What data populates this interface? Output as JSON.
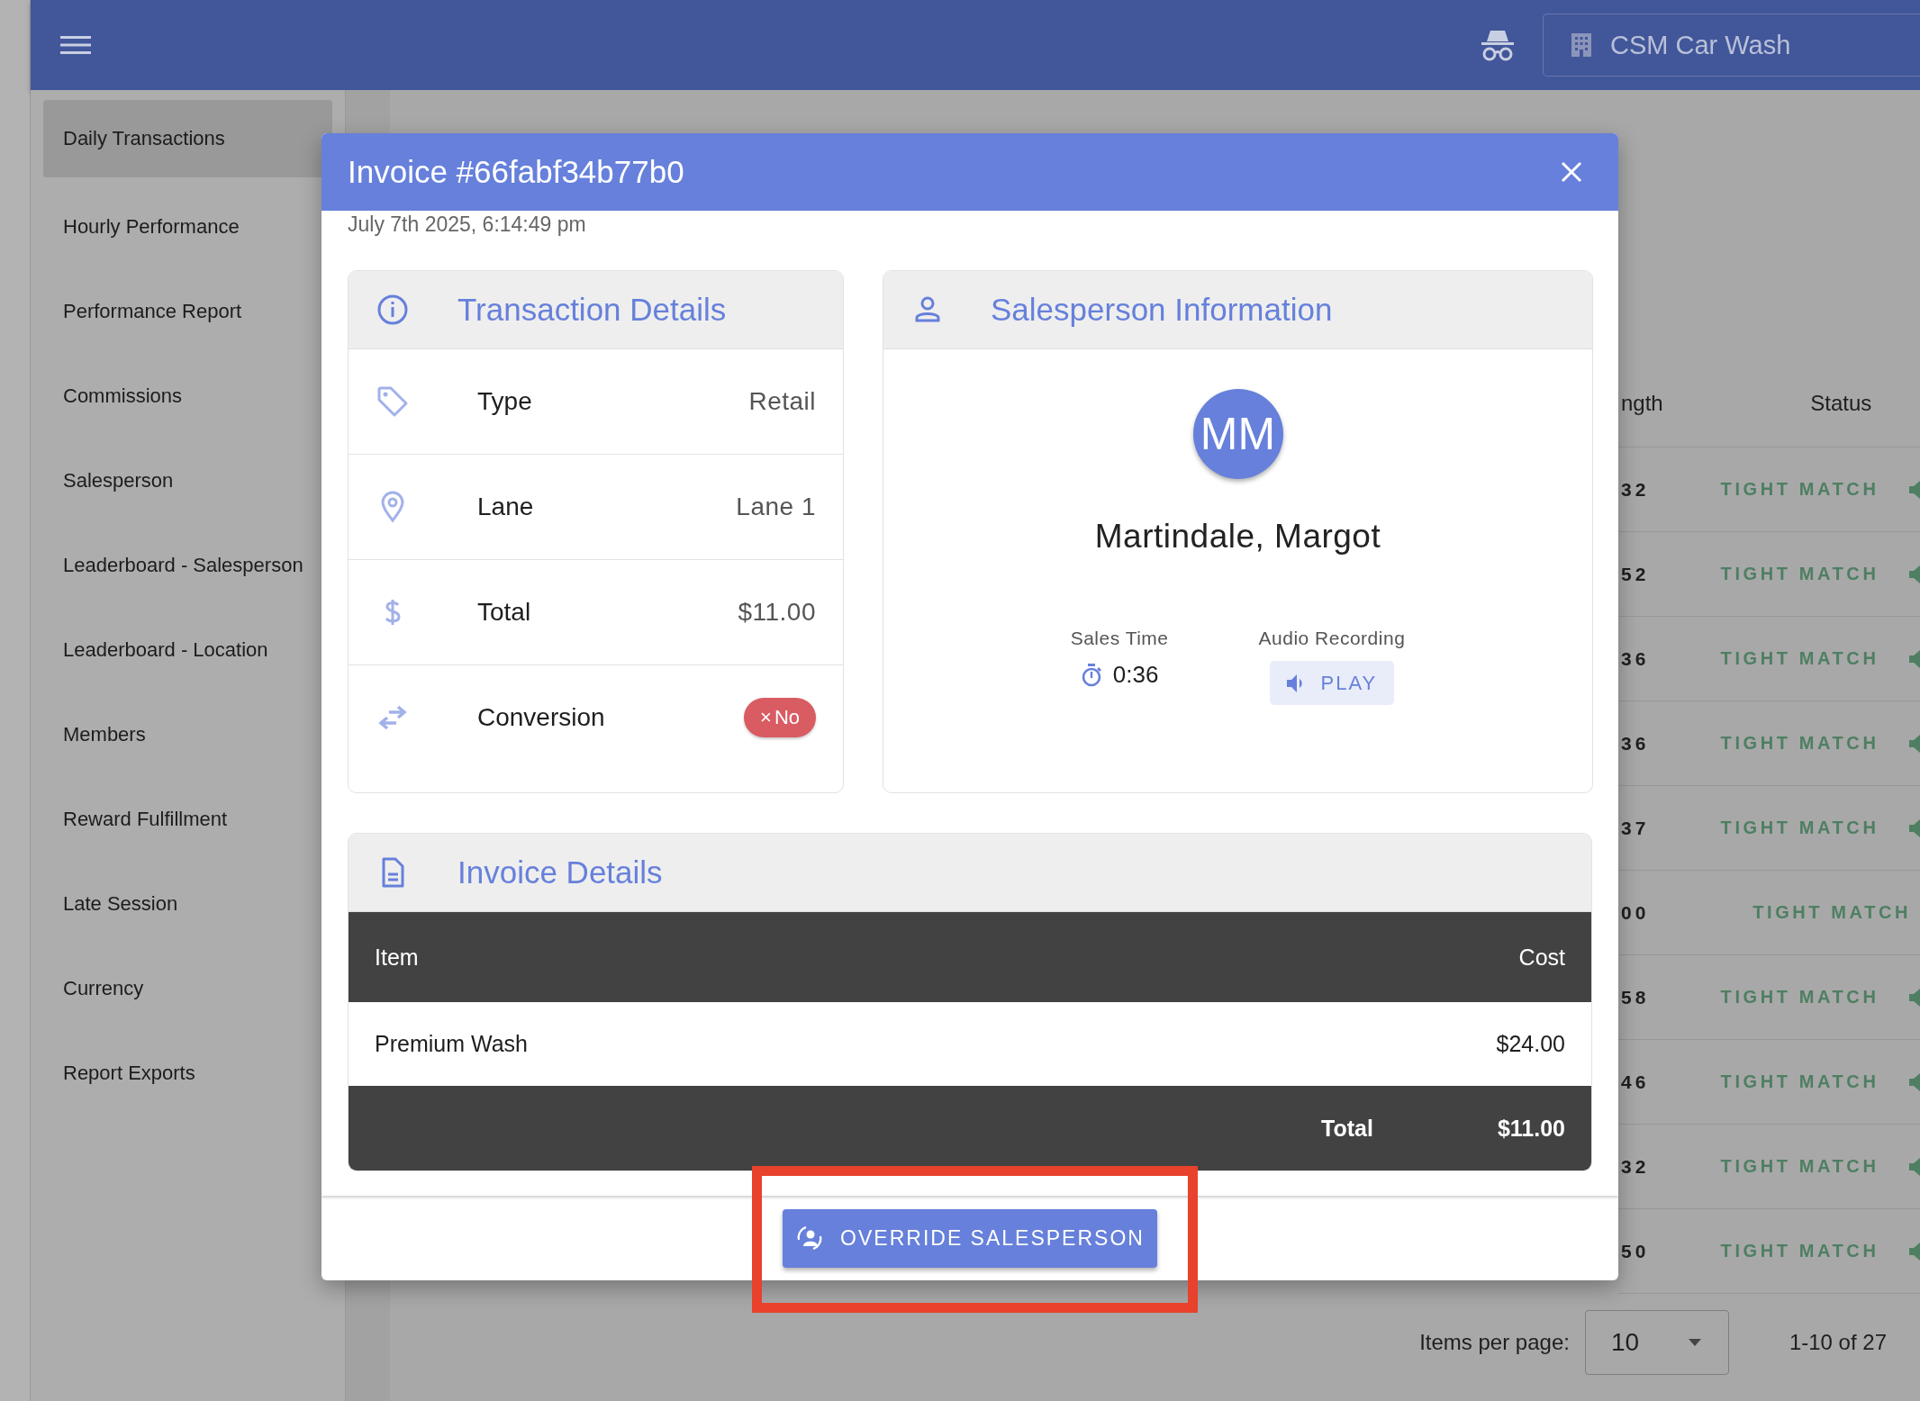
{
  "top_bar": {
    "location": "CSM Car Wash"
  },
  "sidebar": {
    "items": [
      {
        "label": "Daily Transactions",
        "selected": true
      },
      {
        "label": "Hourly Performance",
        "selected": false
      },
      {
        "label": "Performance Report",
        "selected": false
      },
      {
        "label": "Commissions",
        "selected": false
      },
      {
        "label": "Salesperson",
        "selected": false
      },
      {
        "label": "Leaderboard - Salesperson",
        "selected": false
      },
      {
        "label": "Leaderboard - Location",
        "selected": false
      },
      {
        "label": "Members",
        "selected": false
      },
      {
        "label": "Reward Fulfillment",
        "selected": false
      },
      {
        "label": "Late Session",
        "selected": false
      },
      {
        "label": "Currency",
        "selected": false
      },
      {
        "label": "Report Exports",
        "selected": false
      }
    ]
  },
  "table": {
    "columns": [
      "ngth",
      "Status"
    ],
    "rows": [
      {
        "column_1": "32",
        "status": "TIGHT MATCH",
        "has_audio": true
      },
      {
        "column_1": "52",
        "status": "TIGHT MATCH",
        "has_audio": true
      },
      {
        "column_1": "36",
        "status": "TIGHT MATCH",
        "has_audio": true
      },
      {
        "column_1": "36",
        "status": "TIGHT MATCH",
        "has_audio": true
      },
      {
        "column_1": "37",
        "status": "TIGHT MATCH",
        "has_audio": true
      },
      {
        "column_1": "00",
        "status": "TIGHT MATCH",
        "has_audio": false
      },
      {
        "column_1": "58",
        "status": "TIGHT MATCH",
        "has_audio": true
      },
      {
        "column_1": "46",
        "status": "TIGHT MATCH",
        "has_audio": true
      },
      {
        "column_1": "32",
        "status": "TIGHT MATCH",
        "has_audio": true
      },
      {
        "column_1": "50",
        "status": "TIGHT MATCH",
        "has_audio": true
      }
    ]
  },
  "pagination": {
    "label": "Items per page:",
    "items_per_page": "10",
    "range": "1-10 of 27"
  },
  "dialog": {
    "title": "Invoice #66fabf34b77b0",
    "date": "July 7th 2025, 6:14:49 pm",
    "transaction_details": {
      "title": "Transaction Details",
      "rows": [
        {
          "kind": "value",
          "label": "Type",
          "value": "Retail"
        },
        {
          "kind": "value",
          "label": "Lane",
          "value": "Lane 1"
        },
        {
          "kind": "value",
          "label": "Total",
          "value": "$11.00"
        },
        {
          "kind": "chip",
          "label": "Conversion",
          "chip_icon": "×",
          "value": "No"
        }
      ]
    },
    "salesperson": {
      "title": "Salesperson Information",
      "initials": "MM",
      "name": "Martindale, Margot",
      "sales_time_label": "Sales Time",
      "sales_time": "0:36",
      "audio_label": "Audio Recording",
      "play_button": "PLAY"
    },
    "invoice_details": {
      "title": "Invoice Details",
      "columns": [
        "Item",
        "Cost"
      ],
      "items": [
        {
          "item": "Premium Wash",
          "cost": "$24.00"
        }
      ],
      "total_label": "Total",
      "total": "$11.00"
    },
    "override_button": "OVERRIDE SALESPERSON"
  }
}
